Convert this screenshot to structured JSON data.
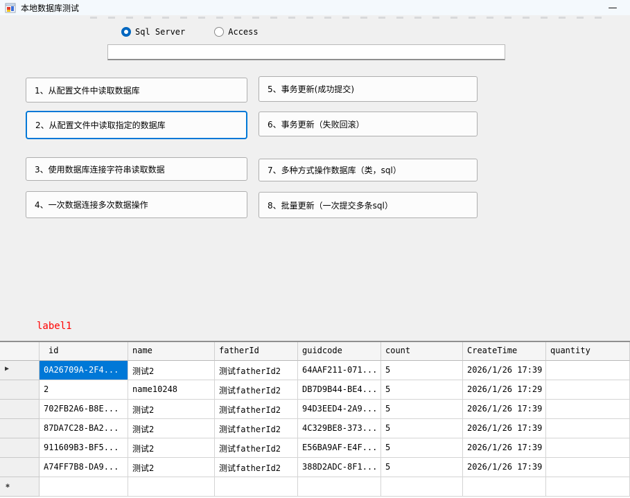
{
  "window": {
    "title": "本地数据库测试",
    "minimize_label": "—"
  },
  "radio_group": {
    "options": [
      {
        "label": "Sql Server",
        "selected": true
      },
      {
        "label": "Access",
        "selected": false
      }
    ]
  },
  "connection_input": {
    "value": ""
  },
  "buttons": [
    "1、从配置文件中读取数据库",
    "2、从配置文件中读取指定的数据库",
    "3、使用数据库连接字符串读取数据",
    "4、一次数据连接多次数据操作",
    "5、事务更新(成功提交)",
    "6、事务更新（失败回滚）",
    "7、多种方式操作数据库（类，sql）",
    "8、批量更新（一次提交多条sql）"
  ],
  "label1": {
    "text": "label1",
    "color": "#ff0000"
  },
  "grid": {
    "columns": [
      "id",
      "name",
      "fatherId",
      "guidcode",
      "count",
      "CreateTime",
      "quantity"
    ],
    "rows": [
      [
        "0A26709A-2F4...",
        "测试2",
        "测试fatherId2",
        "64AAF211-071...",
        "5",
        "2026/1/26 17:39",
        ""
      ],
      [
        "2",
        "name10248",
        "测试fatherId2",
        "DB7D9B44-BE4...",
        "5",
        "2026/1/26 17:29",
        ""
      ],
      [
        "702FB2A6-B8E...",
        "测试2",
        "测试fatherId2",
        "94D3EED4-2A9...",
        "5",
        "2026/1/26 17:39",
        ""
      ],
      [
        "87DA7C28-BA2...",
        "测试2",
        "测试fatherId2",
        "4C329BE8-373...",
        "5",
        "2026/1/26 17:39",
        ""
      ],
      [
        "911609B3-BF5...",
        "测试2",
        "测试fatherId2",
        "E56BA9AF-E4F...",
        "5",
        "2026/1/26 17:39",
        ""
      ],
      [
        "A74FF7B8-DA9...",
        "测试2",
        "测试fatherId2",
        "388D2ADC-8F1...",
        "5",
        "2026/1/26 17:39",
        ""
      ],
      [
        "",
        "",
        "",
        "",
        "",
        "",
        ""
      ]
    ],
    "current_row_indicator": "▶",
    "new_row_indicator": "✱",
    "selection_color": "#0078d7"
  }
}
